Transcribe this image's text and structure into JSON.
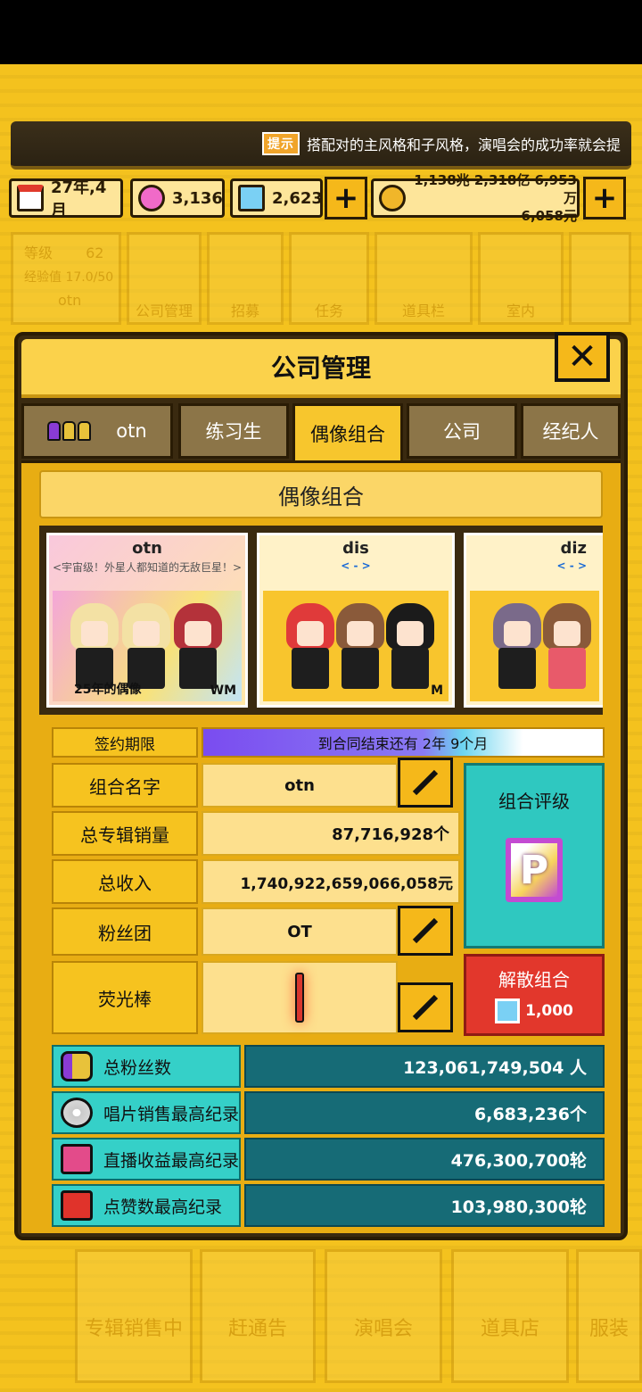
{
  "ticker": {
    "badge": "提示",
    "text": "搭配对的主风格和子风格，演唱会的成功率就会提"
  },
  "resources": {
    "date": "27年,4月",
    "gems_pink": "3,136",
    "gems_blue": "2,623",
    "money_line1": "1,138兆 2,318亿 6,953万",
    "money_line2": "6,058元"
  },
  "top_menu": {
    "level_label": "等级",
    "level_value": "62",
    "exp": "经验值 17.0/50",
    "user": "otn",
    "items": [
      "公司管理",
      "招募",
      "任务",
      "道具栏",
      "室内"
    ]
  },
  "modal": {
    "title": "公司管理",
    "tabs": [
      "otn",
      "练习生",
      "偶像组合",
      "公司",
      "经纪人"
    ],
    "section_title": "偶像组合",
    "groups": [
      {
        "name": "otn",
        "subtitle": "<宇宙级！外星人都知道的无敌巨星！>",
        "tag": "25年的偶像",
        "gender": "WM"
      },
      {
        "name": "dis",
        "subtitle": "< - >",
        "gender": "M"
      },
      {
        "name": "diz",
        "subtitle": "< - >"
      }
    ],
    "contract": {
      "label": "签约期限",
      "text": "到合同结束还有 2年 9个月"
    },
    "rows": [
      {
        "label": "组合名字",
        "value": "otn"
      },
      {
        "label": "总专辑销量",
        "value": "87,716,928个"
      },
      {
        "label": "总收入",
        "value": "1,740,922,659,066,058元"
      },
      {
        "label": "粉丝团",
        "value": "OT"
      },
      {
        "label": "荧光棒",
        "value": ""
      }
    ],
    "rating": {
      "label": "组合评级",
      "grade": "P"
    },
    "disband": {
      "label": "解散组合",
      "cost": "1,000"
    },
    "records": [
      {
        "label": "总粉丝数",
        "value": "123,061,749,504 人"
      },
      {
        "label": "唱片销售最高纪录",
        "value": "6,683,236个"
      },
      {
        "label": "直播收益最高纪录",
        "value": "476,300,700轮"
      },
      {
        "label": "点赞数最高纪录",
        "value": "103,980,300轮"
      }
    ]
  },
  "bottom_nav": [
    "专辑销售中",
    "赶通告",
    "演唱会",
    "道具店",
    "服装"
  ],
  "colors": {
    "accent": "#f6c21d",
    "teal": "#35d0c8",
    "danger": "#e2372c"
  }
}
